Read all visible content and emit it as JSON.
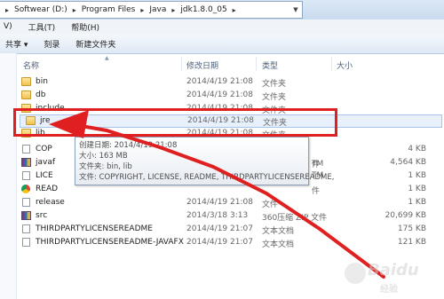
{
  "breadcrumb": [
    "Softwear (D:)",
    "Program Files",
    "Java",
    "jdk1.8.0_05"
  ],
  "menu": [
    "V)",
    "工具(T)",
    "帮助(H)"
  ],
  "toolbar": [
    "共享 ▾",
    "刻录",
    "新建文件夹"
  ],
  "columns": {
    "name": "名称",
    "date": "修改日期",
    "type": "类型",
    "size": "大小"
  },
  "files": [
    {
      "name": "bin",
      "date": "2014/4/19 21:08",
      "type": "文件夹",
      "size": "",
      "icon": "folder-icon"
    },
    {
      "name": "db",
      "date": "2014/4/19 21:08",
      "type": "文件夹",
      "size": "",
      "icon": "folder-icon"
    },
    {
      "name": "include",
      "date": "2014/4/19 21:08",
      "type": "文件夹",
      "size": "",
      "icon": "folder-icon"
    },
    {
      "name": "jre",
      "date": "2014/4/19 21:08",
      "type": "文件夹",
      "size": "",
      "icon": "folder-icon"
    },
    {
      "name": "lib",
      "date": "2014/4/19 21:08",
      "type": "文件夹",
      "size": "",
      "icon": "folder-icon"
    },
    {
      "name": "COP",
      "date": "",
      "type": "",
      "size": "4 KB",
      "icon": "file-icon"
    },
    {
      "name": "javaf",
      "date": "",
      "type": "",
      "size": "4,564 KB",
      "icon": "archive-icon"
    },
    {
      "name": "LICE",
      "date": "",
      "type": "",
      "size": "1 KB",
      "icon": "file-icon"
    },
    {
      "name": "READ",
      "date": "",
      "type": "",
      "size": "1 KB",
      "icon": "chrome-icon"
    },
    {
      "name": "release",
      "date": "2014/4/19 21:08",
      "type": "文件",
      "size": "1 KB",
      "icon": "file-icon"
    },
    {
      "name": "src",
      "date": "2014/3/18 3:13",
      "type": "360压缩 ZIP 文件",
      "size": "20,699 KB",
      "icon": "archive-icon"
    },
    {
      "name": "THIRDPARTYLICENSEREADME",
      "date": "2014/4/19 21:07",
      "type": "文本文档",
      "size": "175 KB",
      "icon": "file-icon"
    },
    {
      "name": "THIRDPARTYLICENSEREADME-JAVAFX",
      "date": "2014/4/19 21:07",
      "type": "文本文档",
      "size": "121 KB",
      "icon": "file-icon"
    }
  ],
  "tooltip": {
    "created": "创建日期: 2014/4/19 21:08",
    "size": "大小: 163 MB",
    "folders": "文件夹: bin, lib",
    "files": "文件: COPYRIGHT, LICENSE, README, THIRDPARTYLICENSEREADME,"
  },
  "type_fragments": [
    "件",
    "TM",
    "件",
    "TM"
  ],
  "watermark": {
    "brand": "Baidu",
    "sub": "经验"
  },
  "annotation_color": "#e02020"
}
